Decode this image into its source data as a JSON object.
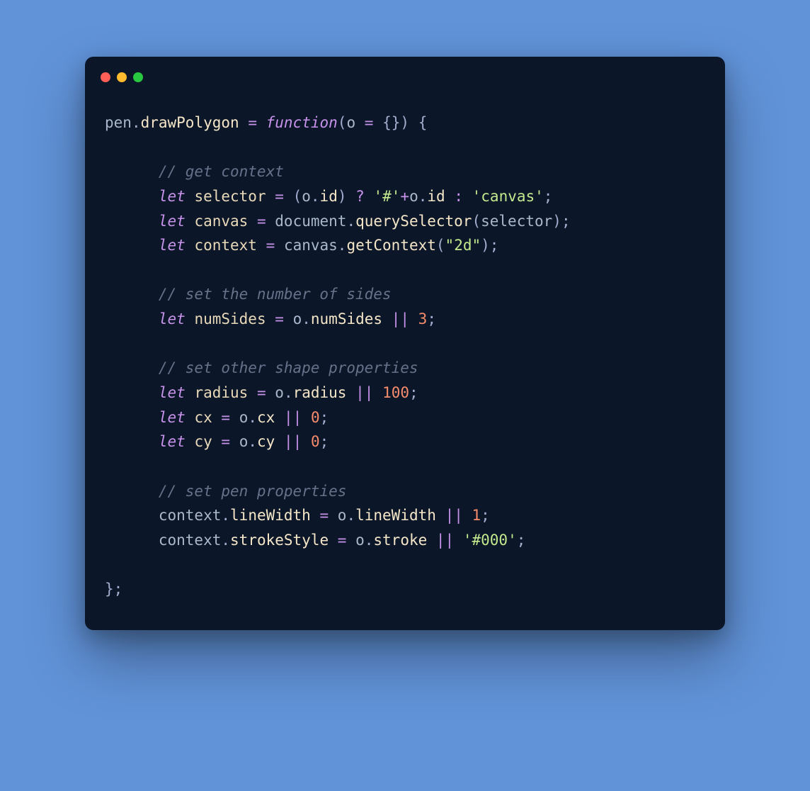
{
  "code": {
    "l1": {
      "obj": "pen",
      "dot": ".",
      "prop": "drawPolygon",
      "sp": " ",
      "eq": "=",
      "sp2": " ",
      "fn": "function",
      "op": "(",
      "arg": "o",
      "sp3": " ",
      "eq2": "=",
      "sp4": " ",
      "braces": "{}",
      "cp": ")",
      "sp5": " ",
      "ob": "{"
    },
    "c1": "// get context",
    "l2": {
      "kw": "let",
      "sp": " ",
      "id": "selector",
      "sp2": " ",
      "eq": "=",
      "sp3": " ",
      "op1": "(",
      "obj": "o",
      "dot": ".",
      "prop": "id",
      "op2": ")",
      "sp4": " ",
      "q": "?",
      "sp5": " ",
      "s1": "'#'",
      "plus": "+",
      "obj2": "o",
      "dot2": ".",
      "prop2": "id",
      "sp6": " ",
      "col": ":",
      "sp7": " ",
      "s2": "'canvas'",
      "sc": ";"
    },
    "l3": {
      "kw": "let",
      "sp": " ",
      "id": "canvas",
      "sp2": " ",
      "eq": "=",
      "sp3": " ",
      "obj": "document",
      "dot": ".",
      "prop": "querySelector",
      "op": "(",
      "arg": "selector",
      "cp": ")",
      "sc": ";"
    },
    "l4": {
      "kw": "let",
      "sp": " ",
      "id": "context",
      "sp2": " ",
      "eq": "=",
      "sp3": " ",
      "obj": "canvas",
      "dot": ".",
      "prop": "getContext",
      "op": "(",
      "s": "\"2d\"",
      "cp": ")",
      "sc": ";"
    },
    "c2": "// set the number of sides",
    "l5": {
      "kw": "let",
      "sp": " ",
      "id": "numSides",
      "sp2": " ",
      "eq": "=",
      "sp3": " ",
      "obj": "o",
      "dot": ".",
      "prop": "numSides",
      "sp4": " ",
      "or": "||",
      "sp5": " ",
      "n": "3",
      "sc": ";"
    },
    "c3": "// set other shape properties",
    "l6": {
      "kw": "let",
      "sp": " ",
      "id": "radius",
      "sp2": " ",
      "eq": "=",
      "sp3": " ",
      "obj": "o",
      "dot": ".",
      "prop": "radius",
      "sp4": " ",
      "or": "||",
      "sp5": " ",
      "n": "100",
      "sc": ";"
    },
    "l7": {
      "kw": "let",
      "sp": " ",
      "id": "cx",
      "sp2": " ",
      "eq": "=",
      "sp3": " ",
      "obj": "o",
      "dot": ".",
      "prop": "cx",
      "sp4": " ",
      "or": "||",
      "sp5": " ",
      "n": "0",
      "sc": ";"
    },
    "l8": {
      "kw": "let",
      "sp": " ",
      "id": "cy",
      "sp2": " ",
      "eq": "=",
      "sp3": " ",
      "obj": "o",
      "dot": ".",
      "prop": "cy",
      "sp4": " ",
      "or": "||",
      "sp5": " ",
      "n": "0",
      "sc": ";"
    },
    "c4": "// set pen properties",
    "l9": {
      "obj": "context",
      "dot": ".",
      "prop": "lineWidth",
      "sp": " ",
      "eq": "=",
      "sp2": " ",
      "obj2": "o",
      "dot2": ".",
      "prop2": "lineWidth",
      "sp3": " ",
      "or": "||",
      "sp4": " ",
      "n": "1",
      "sc": ";"
    },
    "l10": {
      "obj": "context",
      "dot": ".",
      "prop": "strokeStyle",
      "sp": " ",
      "eq": "=",
      "sp2": " ",
      "obj2": "o",
      "dot2": ".",
      "prop2": "stroke",
      "sp3": " ",
      "or": "||",
      "sp4": " ",
      "s": "'#000'",
      "sc": ";"
    },
    "end": {
      "cb": "}",
      "sc": ";"
    }
  }
}
